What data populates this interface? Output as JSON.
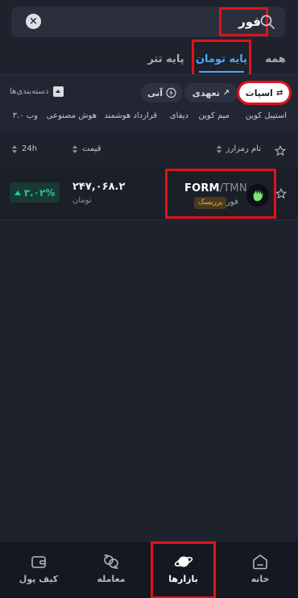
{
  "search": {
    "query": "فور",
    "icons": [
      "search-icon",
      "clear-icon"
    ]
  },
  "tabs": [
    {
      "label": "همه"
    },
    {
      "label": "پایه تومان",
      "active": true
    },
    {
      "label": "پایه تتر"
    }
  ],
  "filters": {
    "chips": [
      {
        "label": "اسپات",
        "icon": "spot-icon",
        "active": true
      },
      {
        "label": "تعهدی",
        "icon": "futures-icon"
      },
      {
        "label": "آنی",
        "icon": "instant-icon"
      }
    ],
    "categories_toggle": "دسته‌بندی‌ها",
    "categories": [
      "استیبل کوین",
      "میم کوین",
      "دیفای",
      "قرارداد هوشمند",
      "هوش مصنوعی",
      "وب ۳.۰"
    ]
  },
  "columns": {
    "name": "نام رمزارز",
    "price": "قیمت",
    "change": "24h"
  },
  "rows": [
    {
      "symbol": "FORM",
      "quote": "/TMN",
      "name": "فور",
      "badge": "پرریسک",
      "price": "۲۴۷,۰۶۸.۲",
      "price_unit": "تومان",
      "change": "۳.۰۲%",
      "change_color": "#20c997",
      "favorite": false
    }
  ],
  "nav": {
    "home": "خانه",
    "markets": "بازارها",
    "trade": "معامله",
    "wallet": "کیف پول",
    "active": "markets"
  },
  "colors": {
    "accent": "#4aa8ff",
    "positive": "#20c997",
    "highlight": "#e0131b"
  }
}
